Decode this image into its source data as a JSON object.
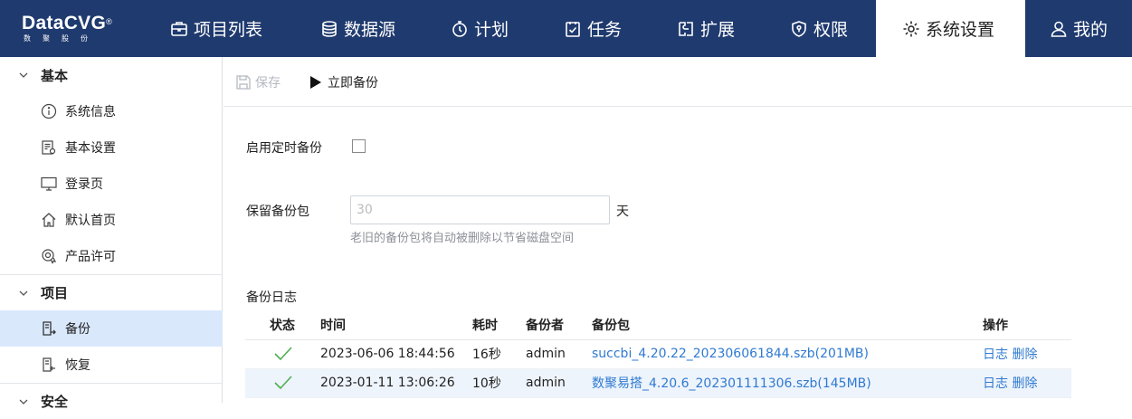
{
  "logo": {
    "brand": "DataCVG",
    "reg": "®",
    "sub": "数聚股份"
  },
  "nav": [
    {
      "label": "项目列表",
      "icon": "briefcase-icon"
    },
    {
      "label": "数据源",
      "icon": "database-icon"
    },
    {
      "label": "计划",
      "icon": "stopwatch-icon"
    },
    {
      "label": "任务",
      "icon": "task-check-icon"
    },
    {
      "label": "扩展",
      "icon": "extension-icon"
    },
    {
      "label": "权限",
      "icon": "shield-icon"
    },
    {
      "label": "系统设置",
      "icon": "gear-icon",
      "active": true
    },
    {
      "label": "我的",
      "icon": "user-icon"
    }
  ],
  "sidebar": {
    "groups": [
      {
        "label": "基本",
        "items": [
          {
            "label": "系统信息",
            "icon": "info-icon"
          },
          {
            "label": "基本设置",
            "icon": "settings-doc-icon"
          },
          {
            "label": "登录页",
            "icon": "monitor-icon"
          },
          {
            "label": "默认首页",
            "icon": "home-icon"
          },
          {
            "label": "产品许可",
            "icon": "license-icon"
          }
        ]
      },
      {
        "label": "项目",
        "items": [
          {
            "label": "备份",
            "icon": "backup-icon",
            "active": true
          },
          {
            "label": "恢复",
            "icon": "restore-icon"
          }
        ]
      },
      {
        "label": "安全",
        "items": []
      }
    ]
  },
  "toolbar": {
    "save_label": "保存",
    "backup_now_label": "立即备份"
  },
  "form": {
    "schedule_label": "启用定时备份",
    "schedule_checked": false,
    "retain_label": "保留备份包",
    "retain_placeholder": "30",
    "retain_unit": "天",
    "retain_hint": "老旧的备份包将自动被删除以节省磁盘空间"
  },
  "log": {
    "title": "备份日志",
    "columns": [
      "状态",
      "时间",
      "耗时",
      "备份者",
      "备份包",
      "操作"
    ],
    "rows": [
      {
        "status": "success",
        "time": "2023-06-06 18:44:56",
        "duration": "16秒",
        "user": "admin",
        "package": "succbi_4.20.22_202306061844.szb(201MB)",
        "action_log": "日志",
        "action_delete": "删除"
      },
      {
        "status": "success",
        "time": "2023-01-11 13:06:26",
        "duration": "10秒",
        "user": "admin",
        "package": "数聚易搭_4.20.6_202301111306.szb(145MB)",
        "action_log": "日志",
        "action_delete": "删除"
      }
    ]
  },
  "colors": {
    "topbar": "#1f3a6e",
    "active_item": "#d9e8fb",
    "link": "#2f7ad1",
    "success": "#4caf50"
  }
}
